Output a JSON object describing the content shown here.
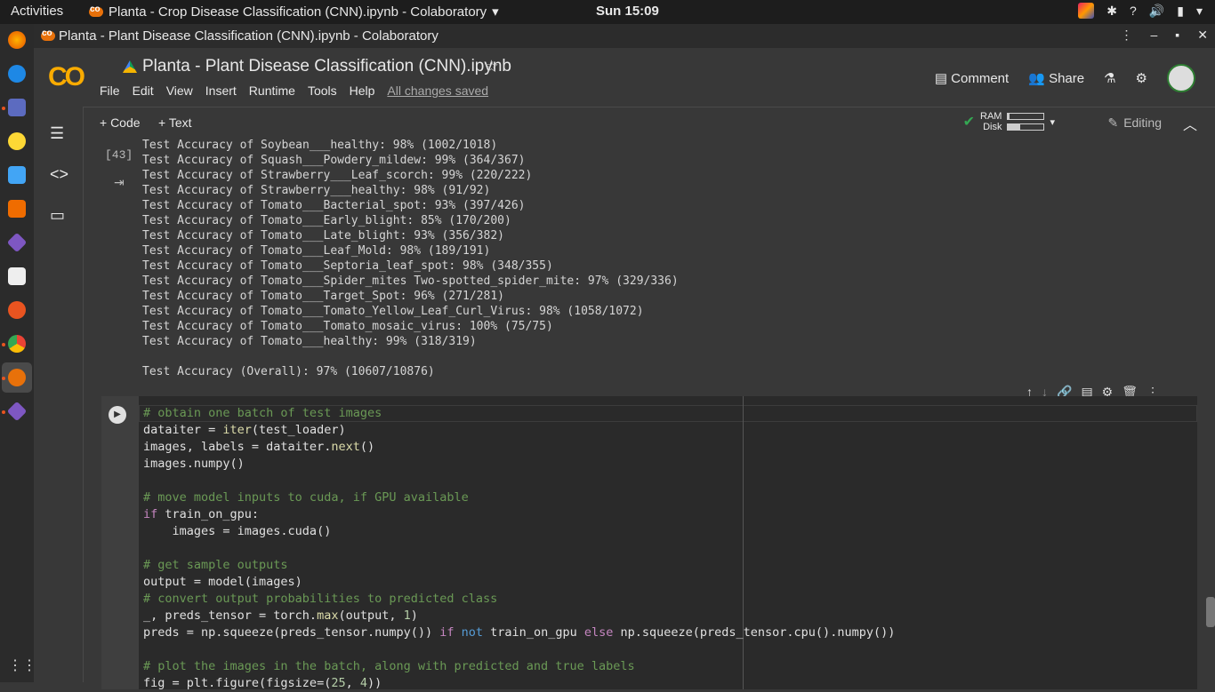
{
  "topbar": {
    "activities": "Activities",
    "app_title": "Planta - Crop Disease Classification (CNN).ipynb - Colaboratory",
    "clock": "Sun 15:09"
  },
  "window": {
    "title": "Planta - Plant Disease Classification (CNN).ipynb - Colaboratory"
  },
  "header": {
    "logo": "CO",
    "notebook_title": "Planta - Plant Disease Classification (CNN).ipynb",
    "menu": [
      "File",
      "Edit",
      "View",
      "Insert",
      "Runtime",
      "Tools",
      "Help"
    ],
    "saved": "All changes saved",
    "comment": "Comment",
    "share": "Share"
  },
  "toolbar": {
    "code": "+ Code",
    "text": "+ Text",
    "ram": "RAM",
    "disk": "Disk",
    "ram_fraction": 0.05,
    "disk_fraction": 0.35,
    "editing": "Editing"
  },
  "output": {
    "exec_count": "[43]",
    "lines": [
      "Test Accuracy of Soybean___healthy: 98% (1002/1018)",
      "Test Accuracy of Squash___Powdery_mildew: 99% (364/367)",
      "Test Accuracy of Strawberry___Leaf_scorch: 99% (220/222)",
      "Test Accuracy of Strawberry___healthy: 98% (91/92)",
      "Test Accuracy of Tomato___Bacterial_spot: 93% (397/426)",
      "Test Accuracy of Tomato___Early_blight: 85% (170/200)",
      "Test Accuracy of Tomato___Late_blight: 93% (356/382)",
      "Test Accuracy of Tomato___Leaf_Mold: 98% (189/191)",
      "Test Accuracy of Tomato___Septoria_leaf_spot: 98% (348/355)",
      "Test Accuracy of Tomato___Spider_mites Two-spotted_spider_mite: 97% (329/336)",
      "Test Accuracy of Tomato___Target_Spot: 96% (271/281)",
      "Test Accuracy of Tomato___Tomato_Yellow_Leaf_Curl_Virus: 98% (1058/1072)",
      "Test Accuracy of Tomato___Tomato_mosaic_virus: 100% (75/75)",
      "Test Accuracy of Tomato___healthy: 99% (318/319)",
      "",
      "Test Accuracy (Overall): 97% (10607/10876)"
    ]
  }
}
